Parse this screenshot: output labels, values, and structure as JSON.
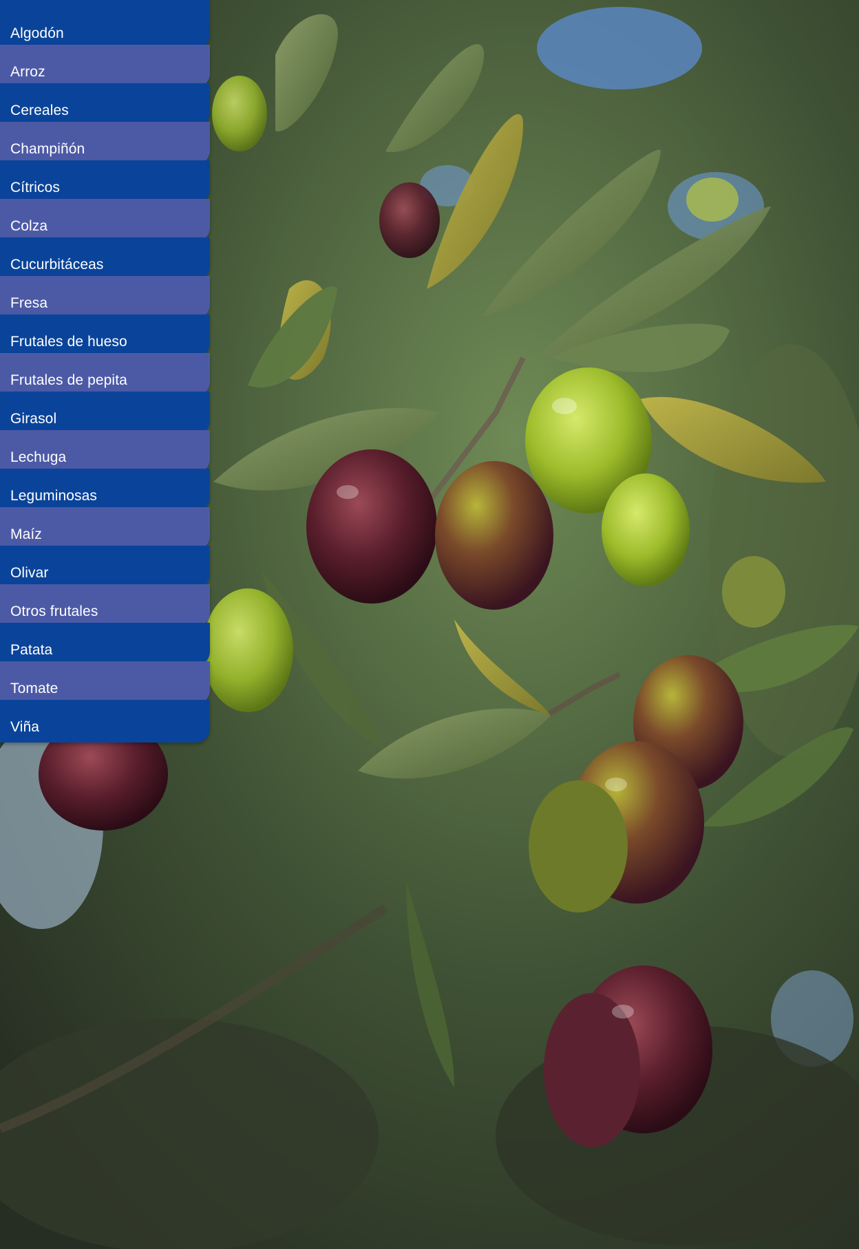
{
  "colors": {
    "menu_dark": "#0a449a",
    "menu_light": "#4c5aa6",
    "label_text": "#ffffff"
  },
  "menu": {
    "items": [
      {
        "label": "Algodón"
      },
      {
        "label": "Arroz"
      },
      {
        "label": "Cereales"
      },
      {
        "label": "Champiñón"
      },
      {
        "label": "Cítricos"
      },
      {
        "label": "Colza"
      },
      {
        "label": "Cucurbitáceas"
      },
      {
        "label": "Fresa"
      },
      {
        "label": "Frutales de hueso"
      },
      {
        "label": "Frutales de pepita"
      },
      {
        "label": "Girasol"
      },
      {
        "label": "Lechuga"
      },
      {
        "label": "Leguminosas"
      },
      {
        "label": "Maíz"
      },
      {
        "label": "Olivar"
      },
      {
        "label": "Otros frutales"
      },
      {
        "label": "Patata"
      },
      {
        "label": "Tomate"
      },
      {
        "label": "Viña"
      }
    ]
  }
}
